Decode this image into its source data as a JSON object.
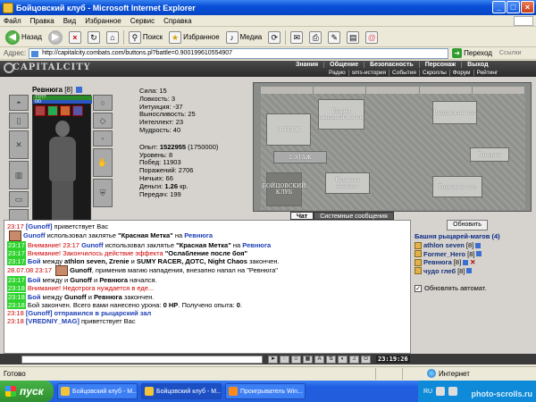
{
  "window": {
    "title": "Бойцовский клуб - Microsoft Internet Explorer"
  },
  "menu": [
    "Файл",
    "Правка",
    "Вид",
    "Избранное",
    "Сервис",
    "Справка"
  ],
  "toolbar": {
    "back": "Назад",
    "search": "Поиск",
    "favorites": "Избранное",
    "media": "Медиа"
  },
  "address": {
    "label": "Адрес:",
    "url": "http://capitalcity.combats.com/buttons.pl?battle=0.900199610554907",
    "go": "Переход",
    "links": "Ссылки"
  },
  "game": {
    "logo": "CAPITALCITY",
    "nav_top": [
      "Знания",
      "Общение",
      "Безопасность",
      "Персонаж",
      "Выход"
    ],
    "nav_bottom": [
      "Радио",
      "sms-история",
      "События",
      "Скроллы",
      "Форум",
      "Рейтинг"
    ],
    "character": {
      "name": "Ревнюга",
      "level": "[8]",
      "hp": "77/77",
      "mana": "0/0"
    },
    "stats": {
      "strength": "Сила: 15",
      "agility": "Ловкость: 3",
      "intuition": "Интуиция: -37",
      "endurance": "Выносливость: 25",
      "intellect": "Интеллект: 23",
      "wisdom": "Мудрость: 40",
      "exp_label": "Опыт: ",
      "exp": "1522955",
      "exp_next": " (1750000)",
      "level": "Уровень: 8",
      "wins": "Побед: 11903",
      "losses": "Поражений: 2706",
      "draws": "Ничьих: 66",
      "money_label": "Деньги: ",
      "money": "1.26",
      "money_unit": " кр.",
      "transfers": "Передач: 199"
    },
    "map": {
      "floor3": "3 ЭТАЖ",
      "floor2": "2 ЭТАЖ",
      "mage_tower": "Башня рыцарей-магов",
      "knight_hall": "Рыцарский зал",
      "tavern": "Таверна",
      "rest_room": "Комната знахаря",
      "trade_hall": "Торговый зал",
      "club": "БОЙЦОВСКИЙ КЛУБ"
    },
    "tabs": [
      "Чат",
      "Системные сообщения"
    ]
  },
  "chat": [
    {
      "ts": "23:17",
      "green": false,
      "parts": [
        {
          "t": "[Gunoff]",
          "c": "blue"
        },
        {
          "t": " приветствует Вас",
          "c": ""
        }
      ]
    },
    {
      "ts": "",
      "green": false,
      "ava": true,
      "parts": [
        {
          "t": "Gunoff",
          "c": "blue"
        },
        {
          "t": " использовал заклятье ",
          "c": ""
        },
        {
          "t": "\"Красная Метка\"",
          "c": "b"
        },
        {
          "t": " на ",
          "c": ""
        },
        {
          "t": "Ревнюга",
          "c": "blue"
        }
      ]
    },
    {
      "ts": "23:17",
      "green": true,
      "parts": [
        {
          "t": "Внимание! 23:17 ",
          "c": "warn"
        },
        {
          "t": "Gunoff",
          "c": "blue"
        },
        {
          "t": " использовал заклятье ",
          "c": ""
        },
        {
          "t": "\"Красная Метка\"",
          "c": "b"
        },
        {
          "t": " на ",
          "c": ""
        },
        {
          "t": "Ревнюга",
          "c": "blue"
        }
      ]
    },
    {
      "ts": "23:17",
      "green": true,
      "parts": [
        {
          "t": "Внимание! Закончилось действие эффекта ",
          "c": "warn"
        },
        {
          "t": "\"Ослабление после боя\"",
          "c": "b"
        }
      ]
    },
    {
      "ts": "23:17",
      "green": true,
      "parts": [
        {
          "t": "Бой",
          "c": "blue"
        },
        {
          "t": " между ",
          "c": ""
        },
        {
          "t": "athlon seven, Zrenie",
          "c": "b"
        },
        {
          "t": " и ",
          "c": ""
        },
        {
          "t": "SUMY RACER, ДОТС, Night Chaos",
          "c": "b"
        },
        {
          "t": " закончен.",
          "c": ""
        }
      ]
    },
    {
      "ts": "28.07.08 23:17",
      "green": false,
      "ava": true,
      "parts": [
        {
          "t": "Gunoff",
          "c": "b"
        },
        {
          "t": ", применив магию нападения, внезапно напал на \"Ревнюга\"",
          "c": ""
        }
      ]
    },
    {
      "ts": "23:17",
      "green": true,
      "parts": [
        {
          "t": "Бой",
          "c": "blue"
        },
        {
          "t": " между и ",
          "c": ""
        },
        {
          "t": "Gunoff",
          "c": "b"
        },
        {
          "t": " и ",
          "c": ""
        },
        {
          "t": "Ревнюга",
          "c": "b"
        },
        {
          "t": " начался.",
          "c": ""
        }
      ]
    },
    {
      "ts": "23:18",
      "green": true,
      "parts": [
        {
          "t": "Внимание! Недотрога нуждается в еде...",
          "c": "warn"
        }
      ]
    },
    {
      "ts": "23:18",
      "green": true,
      "parts": [
        {
          "t": "Бой",
          "c": "blue"
        },
        {
          "t": " между ",
          "c": ""
        },
        {
          "t": "Gunoff",
          "c": "b"
        },
        {
          "t": " и ",
          "c": ""
        },
        {
          "t": "Ревнюга",
          "c": "b"
        },
        {
          "t": " закончен.",
          "c": ""
        }
      ]
    },
    {
      "ts": "23:18",
      "green": true,
      "parts": [
        {
          "t": "Бой закончен. Всего вами нанесено урона: ",
          "c": ""
        },
        {
          "t": "0 HP",
          "c": "b"
        },
        {
          "t": ". Получено опыта: ",
          "c": ""
        },
        {
          "t": "0",
          "c": "b"
        },
        {
          "t": ".",
          "c": ""
        }
      ]
    },
    {
      "ts": "23:18",
      "green": false,
      "parts": [
        {
          "t": "[Gunoff] отправился в рыцарский зал",
          "c": "blue"
        }
      ]
    },
    {
      "ts": "23:18",
      "green": false,
      "parts": [
        {
          "t": "[VREDNIY_MAG]",
          "c": "blue"
        },
        {
          "t": " приветствует Вас",
          "c": ""
        }
      ]
    }
  ],
  "room": {
    "refresh": "Обновить",
    "title": "Башня рыцарей-магов (4)",
    "users": [
      {
        "name": "athlon seven",
        "level": "[8]"
      },
      {
        "name": "Former_Hero",
        "level": "[8]"
      },
      {
        "name": "Ревнюга",
        "level": "[8]"
      },
      {
        "name": "чудо глеб",
        "level": "[8]"
      }
    ],
    "auto": "Обновлять автомат."
  },
  "clock": "23:19:26",
  "status": {
    "ready": "Готово",
    "zone": "Интернет"
  },
  "taskbar": {
    "start": "пуск",
    "tasks": [
      "Бойцовский клуб - М...",
      "Бойцовский клуб - М...",
      "Проигрыватель Win..."
    ],
    "lang": "RU",
    "watermark": "photo-scrolls.ru"
  }
}
